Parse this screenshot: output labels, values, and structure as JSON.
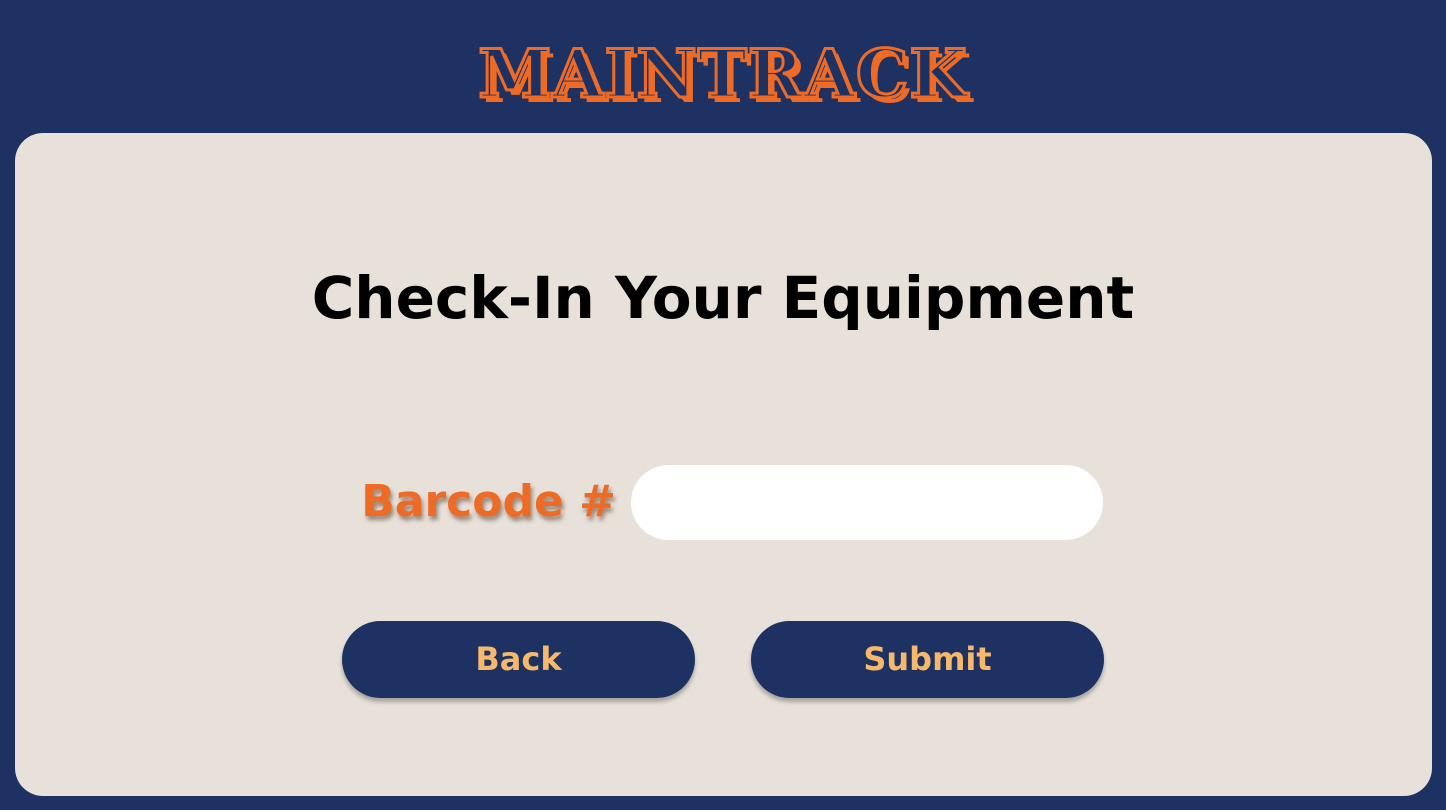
{
  "app": {
    "logo_text": "MAINTRACK"
  },
  "colors": {
    "background": "#1d3163",
    "card": "#e8e1da",
    "accent": "#ee6b26",
    "button_text": "#f6b86a"
  },
  "page": {
    "title": "Check-In Your Equipment"
  },
  "form": {
    "barcode_label": "Barcode #",
    "barcode_value": "",
    "barcode_placeholder": ""
  },
  "buttons": {
    "back_label": "Back",
    "submit_label": "Submit"
  }
}
